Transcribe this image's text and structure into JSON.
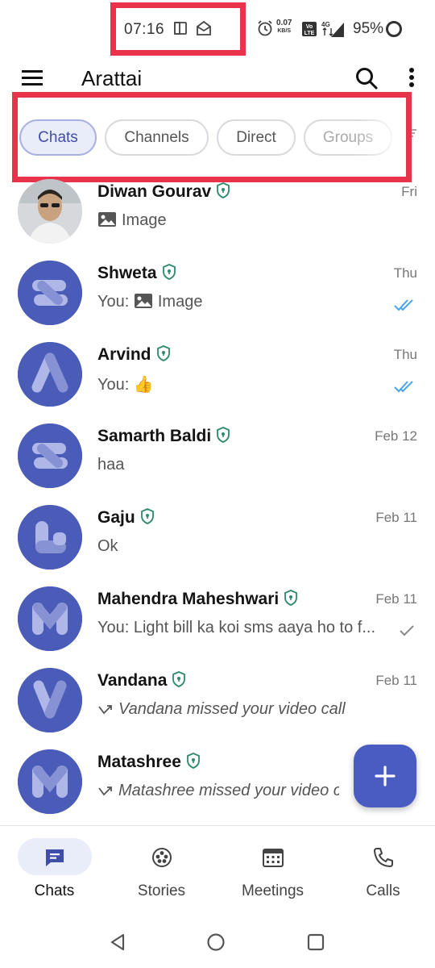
{
  "status_bar": {
    "time": "07:16",
    "net_speed_value": "0.07",
    "net_speed_unit": "KB/S",
    "battery": "95%",
    "icons": [
      "screenshot-icon",
      "mail-open-icon",
      "alarm-icon",
      "volte-icon",
      "4g-icon",
      "signal-icon",
      "battery-icon"
    ]
  },
  "app_bar": {
    "title": "Arattai",
    "icons": [
      "menu-icon",
      "search-icon",
      "more-vert-icon"
    ]
  },
  "filters": [
    {
      "label": "Chats",
      "active": true
    },
    {
      "label": "Channels",
      "active": false
    },
    {
      "label": "Direct",
      "active": false
    },
    {
      "label": "Groups",
      "active": false
    }
  ],
  "chats": [
    {
      "name": "Diwan Gourav",
      "time": "Fri",
      "preview": "Image",
      "preview_icon": "image-icon",
      "status": "none",
      "avatar": "photo"
    },
    {
      "name": "Shweta",
      "time": "Thu",
      "preview": "You: Image",
      "preview_icon": "image-icon",
      "status": "read",
      "avatar": "S"
    },
    {
      "name": "Arvind",
      "time": "Thu",
      "preview": "You: 👍",
      "preview_icon": "",
      "status": "read",
      "avatar": "A"
    },
    {
      "name": "Samarth Baldi",
      "time": "Feb 12",
      "preview": "haa",
      "preview_icon": "",
      "status": "none",
      "avatar": "S"
    },
    {
      "name": "Gaju",
      "time": "Feb 11",
      "preview": "Ok",
      "preview_icon": "",
      "status": "none",
      "avatar": "G"
    },
    {
      "name": "Mahendra Maheshwari",
      "time": "Feb 11",
      "preview": "You: Light bill ka koi sms aaya ho to f...",
      "preview_icon": "",
      "status": "sent",
      "avatar": "M"
    },
    {
      "name": "Vandana",
      "time": "Feb 11",
      "preview": "Vandana missed your video call",
      "preview_icon": "missed-call-icon",
      "status": "none",
      "avatar": "V"
    },
    {
      "name": "Matashree",
      "time": "",
      "preview": "Matashree missed your video call",
      "preview_icon": "missed-call-icon",
      "status": "none",
      "avatar": "M"
    }
  ],
  "fab": {
    "icon": "plus-icon"
  },
  "bottom_nav": [
    {
      "label": "Chats",
      "icon": "chat-bubble-icon",
      "active": true
    },
    {
      "label": "Stories",
      "icon": "stories-icon",
      "active": false
    },
    {
      "label": "Meetings",
      "icon": "meetings-icon",
      "active": false
    },
    {
      "label": "Calls",
      "icon": "phone-icon",
      "active": false
    }
  ],
  "colors": {
    "accent": "#4a5bc2",
    "avatar": "#4a5bb8",
    "chip_active_bg": "#e9ecf9",
    "read_tick": "#4aa3f0",
    "shield": "#2e8b6a",
    "highlight_box": "#e8334a"
  }
}
